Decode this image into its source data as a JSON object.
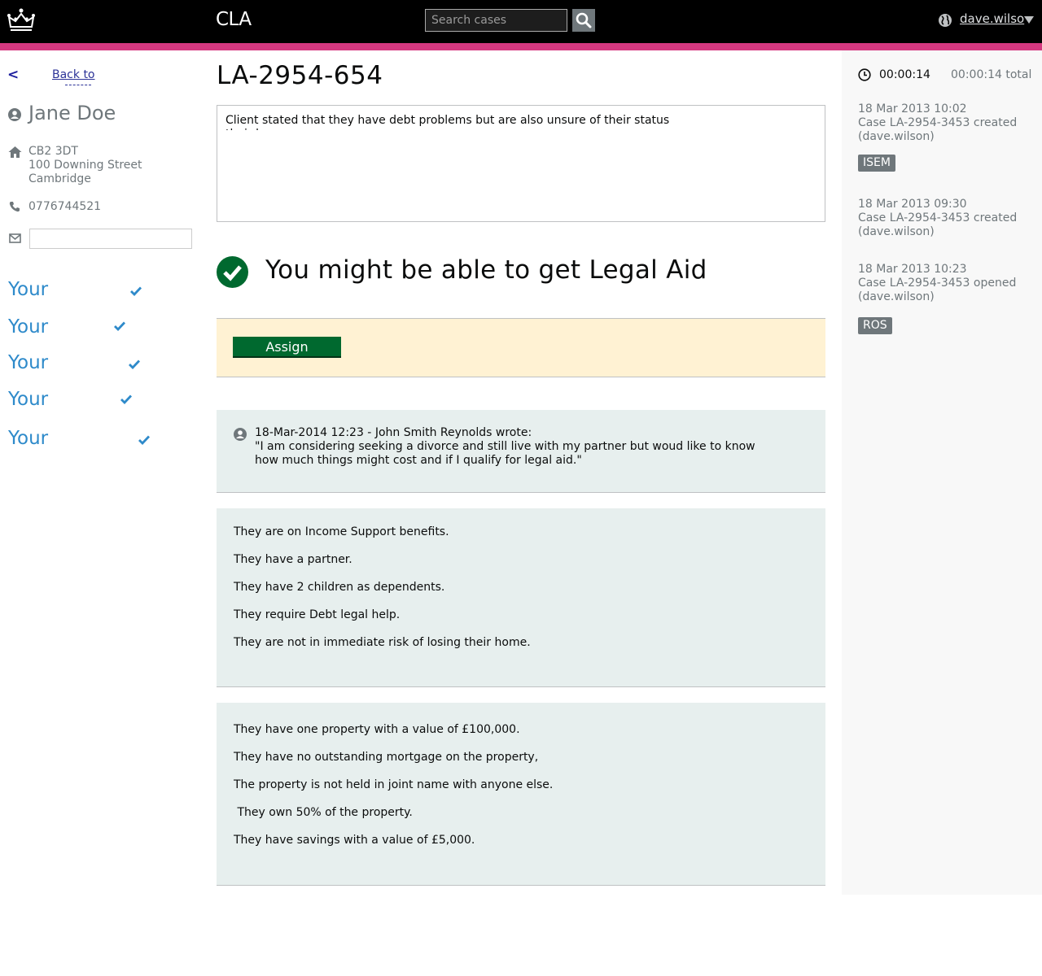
{
  "header": {
    "brand": "CLA",
    "search_placeholder": "Search cases",
    "user": "dave.wilso"
  },
  "sidebar": {
    "back_arrow": "<",
    "back_label": "Back to",
    "client_name": "Jane Doe",
    "address": [
      "CB2 3DT",
      "100 Downing Street",
      "Cambridge"
    ],
    "phone": "0776744521",
    "email": "",
    "nav": [
      {
        "label": "Your"
      },
      {
        "label": "Your"
      },
      {
        "label": "Your"
      },
      {
        "label": "Your"
      },
      {
        "label": "Your"
      }
    ]
  },
  "main": {
    "case_ref": "LA-2954-654",
    "notes": "Client stated that they have debt problems but are also unsure of their status with",
    "notes_overflow": "their home",
    "result": "You might be able to get Legal Aid",
    "assign_label": "Assign",
    "message": {
      "header": "18-Mar-2014 12:23 - John Smith Reynolds wrote:",
      "body": "\"I am considering seeking a divorce and still live with my partner but woud like to know how much things might cost and if I qualify for legal aid.\""
    },
    "facts_1": [
      "They are on Income Support benefits.",
      "They have a partner.",
      "They have 2 children as dependents.",
      "They require Debt legal help.",
      "They are not in immediate risk of losing their home."
    ],
    "facts_2": [
      "They have one property with a value of £100,000.",
      "They have no outstanding mortgage on the property,",
      "The property is not held in joint name with anyone else.",
      " They own 50% of the property.",
      "They have savings with a value of £5,000."
    ]
  },
  "aside": {
    "timer": "00:00:14",
    "timer_total": "00:00:14 total",
    "events": [
      {
        "date": "18 Mar 2013 10:02",
        "text": "Case LA-2954-3453 created",
        "user": "(dave.wilson)"
      },
      {
        "date": "18 Mar 2013 09:30",
        "text": "Case LA-2954-3453 created",
        "user": "(dave.wilson)"
      },
      {
        "date": "18 Mar 2013 10:23",
        "text": "Case LA-2954-3453 opened",
        "user": "(dave.wilson)"
      }
    ],
    "tags": [
      "ISEM",
      "ROS"
    ]
  },
  "colors": {
    "accent_pink": "#d53880",
    "link_blue": "#2e8aca",
    "success_green": "#00692f",
    "panel_bg": "#e7efee",
    "assign_bg": "#fff2d3"
  }
}
